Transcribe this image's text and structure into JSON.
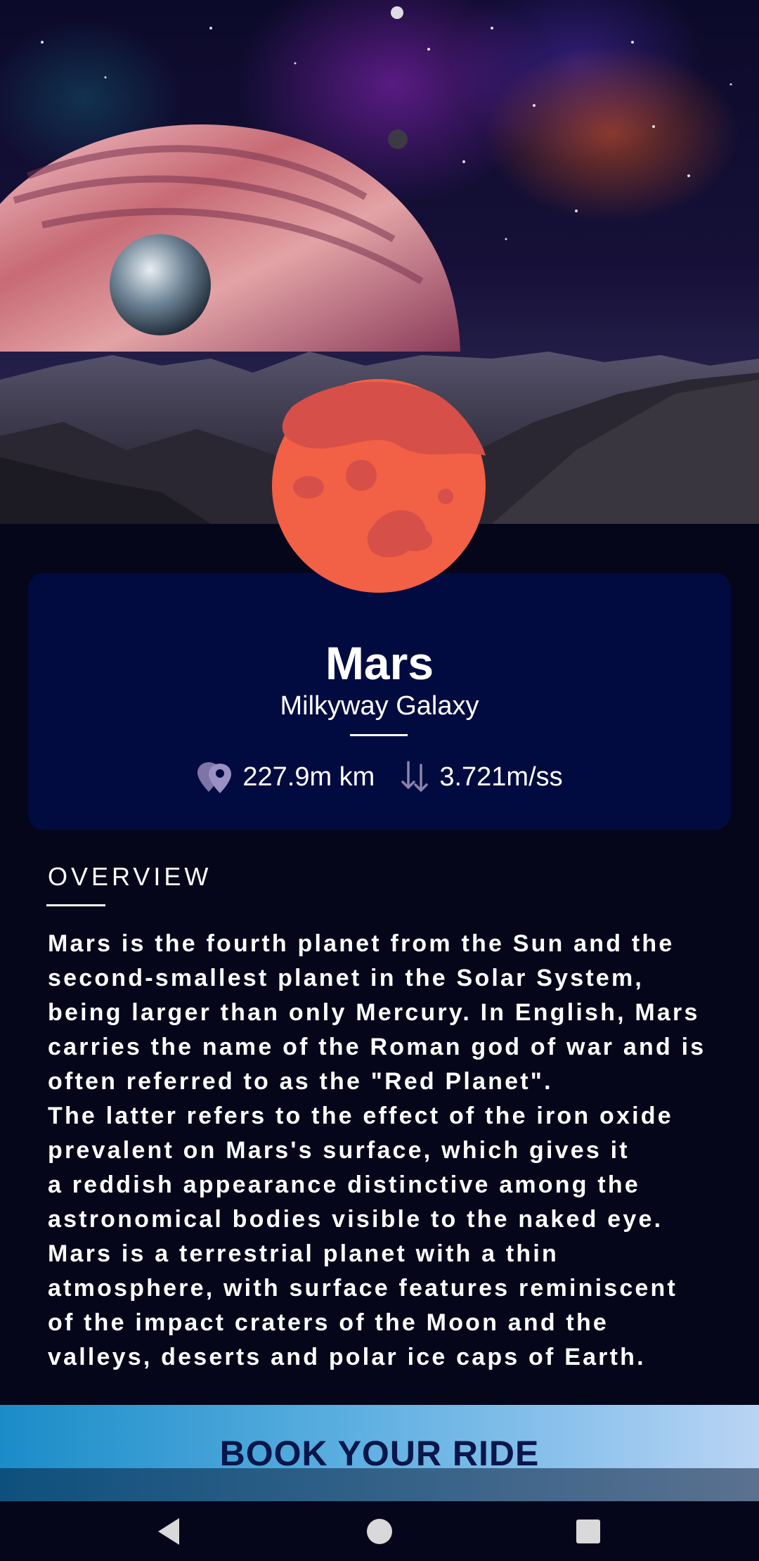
{
  "planet": {
    "name": "Mars",
    "galaxy": "Milkyway Galaxy",
    "distance": "227.9m km",
    "gravity": "3.721m/ss",
    "distance_icon": "map-pins-icon",
    "gravity_icon": "arrows-down-up-icon",
    "color": "#f26045",
    "crater_color": "#d64f49"
  },
  "overview": {
    "title": "OVERVIEW",
    "text": "Mars is the fourth planet from the Sun and the\nsecond-smallest planet in the Solar System,\nbeing larger than only Mercury. In English, Mars\ncarries the name of the Roman god of war and is\noften referred to as the \"Red Planet\".\nThe latter refers to the effect of the iron oxide\nprevalent on Mars's surface, which gives it\na reddish appearance distinctive among the\nastronomical bodies visible to the naked eye.\nMars is a terrestrial planet with a thin\natmosphere, with surface features reminiscent\nof the impact craters of the Moon and the\nvalleys, deserts and polar ice caps of Earth."
  },
  "cta": {
    "label": "BOOK YOUR RIDE"
  },
  "system_nav": {
    "back_icon": "back-triangle-icon",
    "home_icon": "home-circle-icon",
    "recents_icon": "recents-square-icon"
  },
  "colors": {
    "background": "#05061a",
    "card": "#020b3f",
    "button_gradient_start": "#1a8cc8",
    "button_gradient_end": "#b9d4f4",
    "button_text": "#08164a"
  }
}
